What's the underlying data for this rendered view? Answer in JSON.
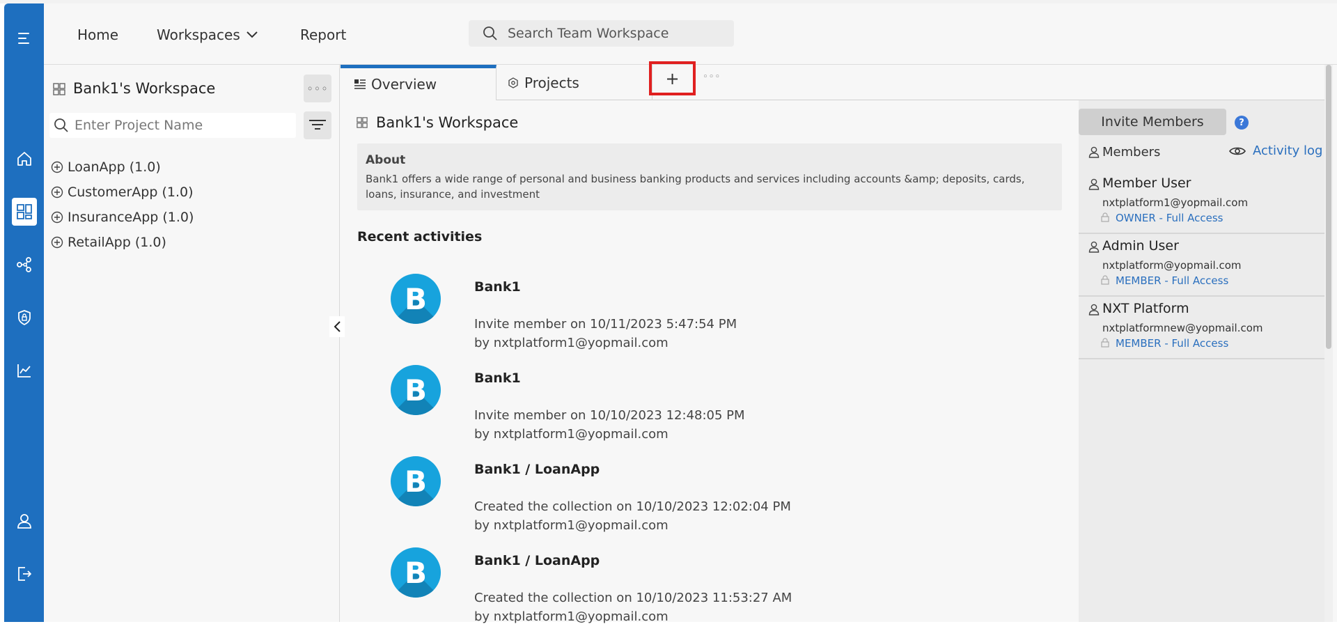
{
  "header": {
    "nav": {
      "home": "Home",
      "workspaces": "Workspaces",
      "report": "Report"
    },
    "search_placeholder": "Search Team Workspace"
  },
  "sidebar": {
    "workspace_title": "Bank1's Workspace",
    "more_label": "◦◦◦",
    "project_search_placeholder": "Enter Project Name",
    "projects": [
      {
        "label": "LoanApp (1.0)"
      },
      {
        "label": "CustomerApp (1.0)"
      },
      {
        "label": "InsuranceApp (1.0)"
      },
      {
        "label": "RetailApp (1.0)"
      }
    ]
  },
  "tabs": [
    {
      "label": "Overview",
      "active": true
    },
    {
      "label": "Projects",
      "active": false
    }
  ],
  "add_tab_label": "+",
  "tab_more_label": "◦◦◦",
  "main": {
    "workspace_title": "Bank1's Workspace",
    "about_title": "About",
    "about_text": "Bank1 offers a wide range of personal and business banking products and services including accounts &amp; deposits, cards, loans, insurance, and investment",
    "recent_title": "Recent activities",
    "activities": [
      {
        "avatar": "B",
        "title": "Bank1",
        "line1": "Invite member on 10/11/2023 5:47:54 PM",
        "line2": "by nxtplatform1@yopmail.com"
      },
      {
        "avatar": "B",
        "title": "Bank1",
        "line1": "Invite member on 10/10/2023 12:48:05 PM",
        "line2": "by nxtplatform1@yopmail.com"
      },
      {
        "avatar": "B",
        "title": "Bank1 / LoanApp",
        "line1": "Created the collection on 10/10/2023 12:02:04 PM",
        "line2": "by nxtplatform1@yopmail.com"
      },
      {
        "avatar": "B",
        "title": "Bank1 / LoanApp",
        "line1": "Created the collection on 10/10/2023 11:53:27 AM",
        "line2": "by nxtplatform1@yopmail.com"
      }
    ]
  },
  "right_panel": {
    "invite_label": "Invite Members",
    "help_label": "?",
    "members_label": "Members",
    "activity_log_label": "Activity log",
    "members": [
      {
        "name": "Member User",
        "email": "nxtplatform1@yopmail.com",
        "role": "OWNER - Full Access"
      },
      {
        "name": "Admin User",
        "email": "nxtplatform@yopmail.com",
        "role": "MEMBER - Full Access"
      },
      {
        "name": "NXT Platform",
        "email": "nxtplatformnew@yopmail.com",
        "role": "MEMBER - Full Access"
      }
    ]
  },
  "colors": {
    "rail": "#1e6fbf",
    "link": "#2a6fbe",
    "avatar": "#17a3dd",
    "highlight_border": "#e02020"
  },
  "icons": {
    "rail": [
      "menu-icon",
      "home-icon",
      "workspaces-icon",
      "share-nodes-icon",
      "shield-lock-icon",
      "chart-icon",
      "user-icon",
      "logout-icon"
    ]
  }
}
